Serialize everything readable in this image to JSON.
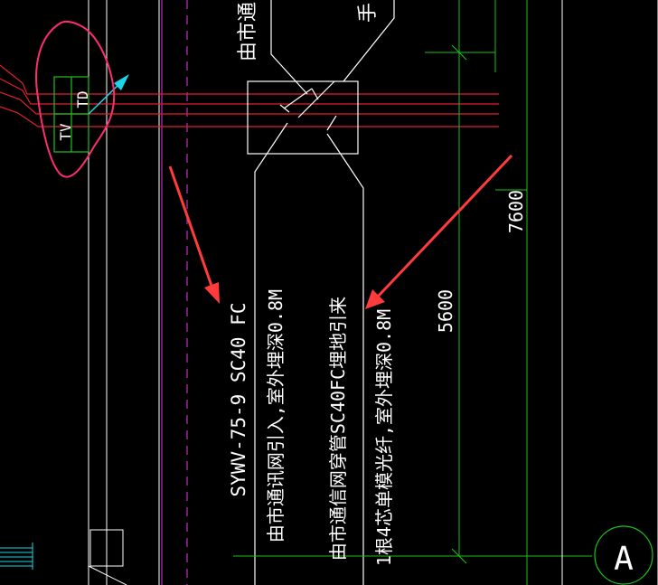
{
  "colors": {
    "background": "#000000",
    "linework": "#ffffff",
    "red_lines": "#e0202a",
    "green_lines": "#19c419",
    "magenta_lines": "#c030c0",
    "annotation_arrow": "#ff3b3b",
    "markup_circle": "#ff2d6f",
    "cyan_marker": "#19d7e8"
  },
  "labels": {
    "tv": "TV",
    "td": "TD",
    "top_cut_text": "由市通",
    "top_right_fragment": "手",
    "cable_spec": "SYWV-75-9 SC40 FC",
    "cable_note_1": "由市通讯网引入,室外埋深0.8M",
    "cable_note_2": "由市通信网穿管SC40FC埋地引来",
    "cable_note_3": "1根4芯单模光纤,室外埋深0.8M"
  },
  "dimensions": {
    "dim_5600": "5600",
    "dim_7600": "7600"
  },
  "grid_axis": {
    "label": "A"
  }
}
